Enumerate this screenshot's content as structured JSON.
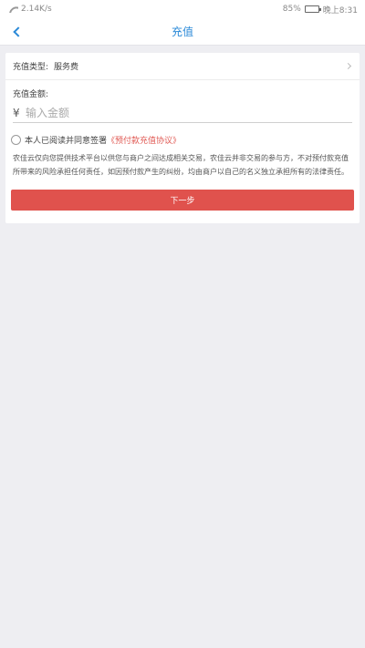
{
  "status_bar": {
    "speed": "2.14K/s",
    "battery": "85%",
    "battery_level": 0.85,
    "time": "晚上8:31"
  },
  "nav": {
    "title": "充值"
  },
  "form": {
    "type_label": "充值类型:",
    "type_value": "服务费",
    "amount_label": "充值金额:",
    "currency_symbol": "¥",
    "amount_placeholder": "输入金额",
    "amount_value": ""
  },
  "agreement": {
    "text": "本人已阅读并同意签署",
    "link": "《预付款充值协议》",
    "checked": false
  },
  "disclaimer": "农佳云仅向您提供技术平台以供您与商户之间达成相关交易，农佳云并非交易的参与方，不对预付款充值所带来的风险承担任何责任，如因预付款产生的纠纷，均由商户以自己的名义独立承担所有的法律责任。",
  "actions": {
    "next_label": "下一步"
  },
  "colors": {
    "accent_blue": "#2b8ad8",
    "primary_red": "#e0524d",
    "page_bg": "#eeeef2"
  }
}
